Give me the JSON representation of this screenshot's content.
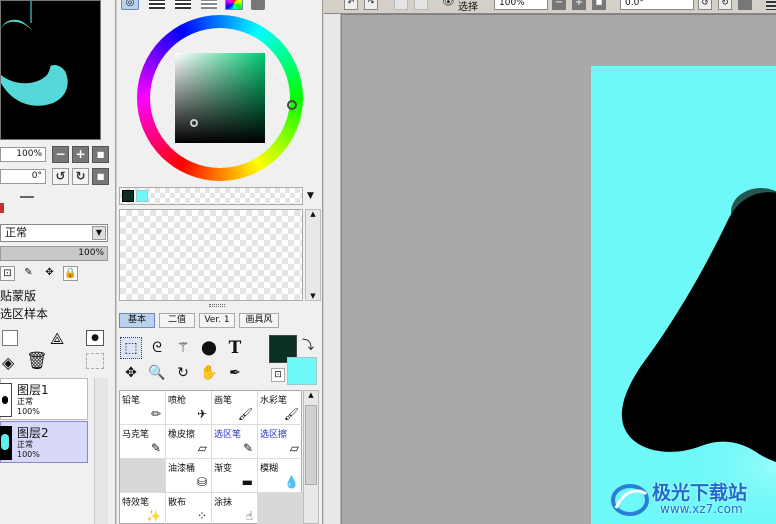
{
  "navigator": {
    "zoom_value": "100%",
    "angle_value": "0°"
  },
  "layers_panel": {
    "blend_mode": "正常",
    "opacity": "100%",
    "clipping_label": "贴蒙版",
    "selection_source_label": "选区样本",
    "layers": [
      {
        "name": "图层1",
        "mode": "正常",
        "opacity": "100%",
        "selected": false
      },
      {
        "name": "图层2",
        "mode": "正常",
        "opacity": "100%",
        "selected": true
      }
    ]
  },
  "color_panel": {
    "main_color": "#0b2e25",
    "sub_color": "#6ff8f8",
    "tabs": [
      "基本",
      "二值",
      "Ver. 1",
      "画具风"
    ]
  },
  "brush_tools": [
    {
      "label": "铅笔",
      "icon": "pencil-icon",
      "blue": false
    },
    {
      "label": "喷枪",
      "icon": "airbrush-icon",
      "blue": false
    },
    {
      "label": "画笔",
      "icon": "brush-icon",
      "blue": false
    },
    {
      "label": "水彩笔",
      "icon": "watercolor-icon",
      "blue": false
    },
    {
      "label": "马克笔",
      "icon": "marker-icon",
      "blue": false
    },
    {
      "label": "橡皮擦",
      "icon": "eraser-icon",
      "blue": false
    },
    {
      "label": "选区笔",
      "icon": "select-pen-icon",
      "blue": true
    },
    {
      "label": "选区擦",
      "icon": "select-eraser-icon",
      "blue": true
    },
    {
      "label": "",
      "icon": "",
      "blue": false
    },
    {
      "label": "油漆桶",
      "icon": "bucket-icon",
      "blue": false
    },
    {
      "label": "渐变",
      "icon": "gradient-icon",
      "blue": false
    },
    {
      "label": "模糊",
      "icon": "blur-icon",
      "blue": false
    },
    {
      "label": "特效笔",
      "icon": "effect-pen-icon",
      "blue": false
    },
    {
      "label": "散布",
      "icon": "scatter-icon",
      "blue": false
    },
    {
      "label": "涂抹",
      "icon": "smudge-icon",
      "blue": false
    },
    {
      "label": "",
      "icon": "",
      "blue": false
    }
  ],
  "canvas_toolbar": {
    "select_label": "选择",
    "zoom": "100%",
    "rotation": "0.0°"
  },
  "watermark": {
    "name": "极光下载站",
    "url": "www.xz7.com"
  }
}
